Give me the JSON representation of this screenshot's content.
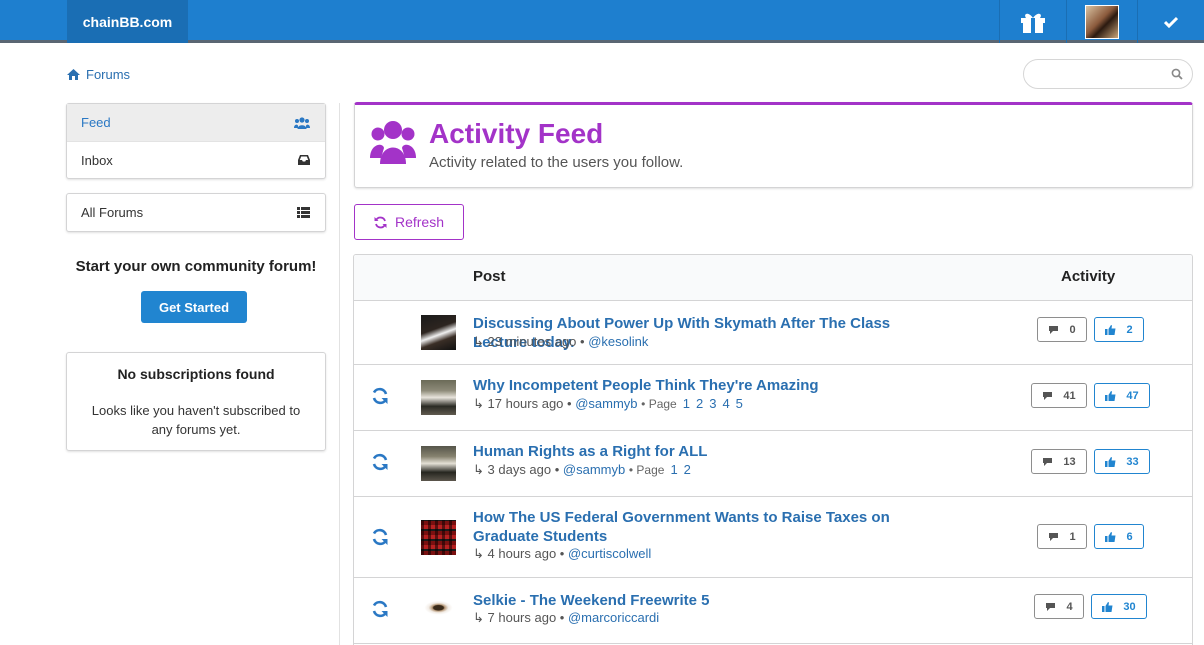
{
  "header": {
    "brand": "chainBB.com",
    "gift_icon": "gift-icon",
    "check_icon": "check-icon"
  },
  "breadcrumb": {
    "label": "Forums",
    "icon": "home-icon"
  },
  "search": {
    "placeholder": "",
    "icon": "search-icon"
  },
  "sidebar": {
    "menu": [
      {
        "label": "Feed",
        "icon": "users-icon",
        "active": true
      },
      {
        "label": "Inbox",
        "icon": "inbox-icon"
      }
    ],
    "forums": {
      "label": "All Forums",
      "icon": "list-icon"
    },
    "promo": {
      "title": "Start your own community forum!",
      "button": "Get Started"
    },
    "subscriptions": {
      "title": "No subscriptions found",
      "message": "Looks like you haven't subscribed to any forums yet."
    }
  },
  "feed": {
    "title": "Activity Feed",
    "subtitle": "Activity related to the users you follow.",
    "refresh_label": "Refresh",
    "columns": {
      "post": "Post",
      "activity": "Activity"
    },
    "accent": "#a333c8"
  },
  "posts": [
    {
      "title": "Discussing About Power Up With Skymath After The Class Lecture today.",
      "time": "23 minutes ago",
      "author": "@kesolink",
      "pages": [],
      "comments": "0",
      "likes": "2",
      "page_label": ""
    },
    {
      "title": "Why Incompetent People Think They're Amazing",
      "time": "17 hours ago",
      "author": "@sammyb",
      "page_label": "Page",
      "pages": [
        "1",
        "2",
        "3",
        "4",
        "5"
      ],
      "comments": "41",
      "likes": "47"
    },
    {
      "title": "Human Rights as a Right for ALL",
      "time": "3 days ago",
      "author": "@sammyb",
      "page_label": "Page",
      "pages": [
        "1",
        "2"
      ],
      "comments": "13",
      "likes": "33"
    },
    {
      "title": "How The US Federal Government Wants to Raise Taxes on Graduate Students",
      "time": "4 hours ago",
      "author": "@curtiscolwell",
      "page_label": "",
      "pages": [],
      "comments": "1",
      "likes": "6"
    },
    {
      "title": "Selkie - The Weekend Freewrite 5",
      "time": "7 hours ago",
      "author": "@marcoriccardi",
      "page_label": "",
      "pages": [],
      "comments": "4",
      "likes": "30"
    }
  ]
}
